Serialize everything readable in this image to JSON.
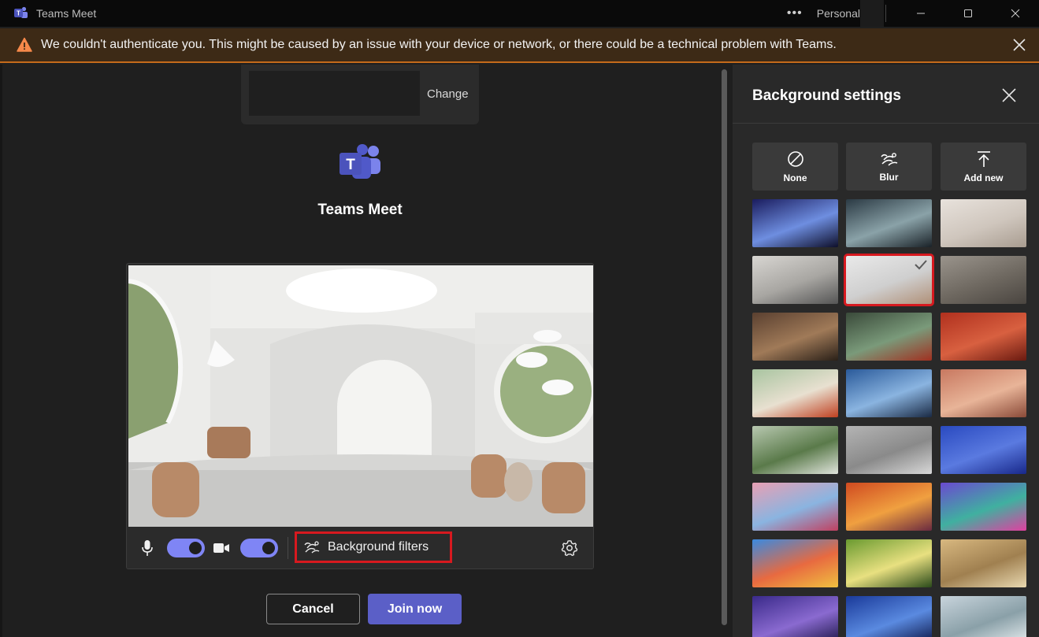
{
  "window": {
    "title": "Teams Meet",
    "more_label": "•••",
    "account_label": "Personal"
  },
  "banner": {
    "message": "We couldn't authenticate you. This might be caused by an issue with your device or network, or there could be a technical problem with Teams."
  },
  "account_card": {
    "change_label": "Change"
  },
  "app": {
    "name": "Teams Meet"
  },
  "controls": {
    "mic_on": true,
    "camera_on": true,
    "background_filters_label": "Background filters"
  },
  "actions": {
    "cancel_label": "Cancel",
    "join_label": "Join now"
  },
  "background_panel": {
    "title": "Background settings",
    "options": [
      {
        "id": "none",
        "label": "None",
        "icon": "none-icon"
      },
      {
        "id": "blur",
        "label": "Blur",
        "icon": "blur-icon"
      },
      {
        "id": "add-new",
        "label": "Add new",
        "icon": "upload-icon"
      }
    ],
    "selected_index": 4,
    "thumbnails": [
      {
        "name": "space-warp",
        "colors": [
          "#1a1c5e",
          "#6e8ee0",
          "#0e0f2a"
        ]
      },
      {
        "name": "alien-landscape",
        "colors": [
          "#2b3a44",
          "#8aa2a8",
          "#1a2228"
        ]
      },
      {
        "name": "white-loft",
        "colors": [
          "#e8e2dc",
          "#cfc6bd",
          "#a89c90"
        ]
      },
      {
        "name": "city-office",
        "colors": [
          "#d8d6d2",
          "#a8a6a2",
          "#555"
        ]
      },
      {
        "name": "white-arch-room",
        "colors": [
          "#e9e9e9",
          "#cfcfcf",
          "#b09078"
        ]
      },
      {
        "name": "concrete-room",
        "colors": [
          "#9a948c",
          "#6e6860",
          "#4a4540"
        ]
      },
      {
        "name": "warm-living-room",
        "colors": [
          "#5a4030",
          "#a07a58",
          "#2a2018"
        ]
      },
      {
        "name": "glass-pavilion",
        "colors": [
          "#3a4a3a",
          "#7a9a7a",
          "#a03020"
        ]
      },
      {
        "name": "red-terrace",
        "colors": [
          "#b0301e",
          "#d86040",
          "#6a1a10"
        ]
      },
      {
        "name": "green-arches",
        "colors": [
          "#a8c4a0",
          "#e8e0d0",
          "#c04020"
        ]
      },
      {
        "name": "blue-lounge",
        "colors": [
          "#2a5a9a",
          "#8ab4e0",
          "#1a2a44"
        ]
      },
      {
        "name": "desert-arch",
        "colors": [
          "#c87860",
          "#e8b498",
          "#8a4a38"
        ]
      },
      {
        "name": "green-circle",
        "colors": [
          "#b8c8b0",
          "#5a7a4a",
          "#e0e4dc"
        ]
      },
      {
        "name": "grey-arch",
        "colors": [
          "#b4b4b4",
          "#8a8a8a",
          "#d8d8d8"
        ]
      },
      {
        "name": "blue-arch",
        "colors": [
          "#2a4ac0",
          "#5a7ae0",
          "#18288a"
        ]
      },
      {
        "name": "fantasy-pillars",
        "colors": [
          "#e8a0b4",
          "#8ab4e0",
          "#c04060"
        ]
      },
      {
        "name": "autumn-forest",
        "colors": [
          "#d04a20",
          "#f0a040",
          "#6a2a40"
        ]
      },
      {
        "name": "purple-flowers",
        "colors": [
          "#6a4ad0",
          "#40b0a0",
          "#e040a0"
        ]
      },
      {
        "name": "coral-reef",
        "colors": [
          "#3a8ae0",
          "#e86a40",
          "#f0c040"
        ]
      },
      {
        "name": "sunny-glade",
        "colors": [
          "#6a9a30",
          "#e8e080",
          "#2a4a1a"
        ]
      },
      {
        "name": "golden-hills",
        "colors": [
          "#d8b880",
          "#a08050",
          "#e8d8b0"
        ]
      },
      {
        "name": "purple-sky",
        "colors": [
          "#3a2a8a",
          "#8a6ad0",
          "#1a1444"
        ]
      },
      {
        "name": "star-sky",
        "colors": [
          "#1a3a9a",
          "#5a8ae0",
          "#0a1444"
        ]
      },
      {
        "name": "cloud-tree",
        "colors": [
          "#c8d4dc",
          "#8aa0a8",
          "#e8eef0"
        ]
      }
    ]
  }
}
